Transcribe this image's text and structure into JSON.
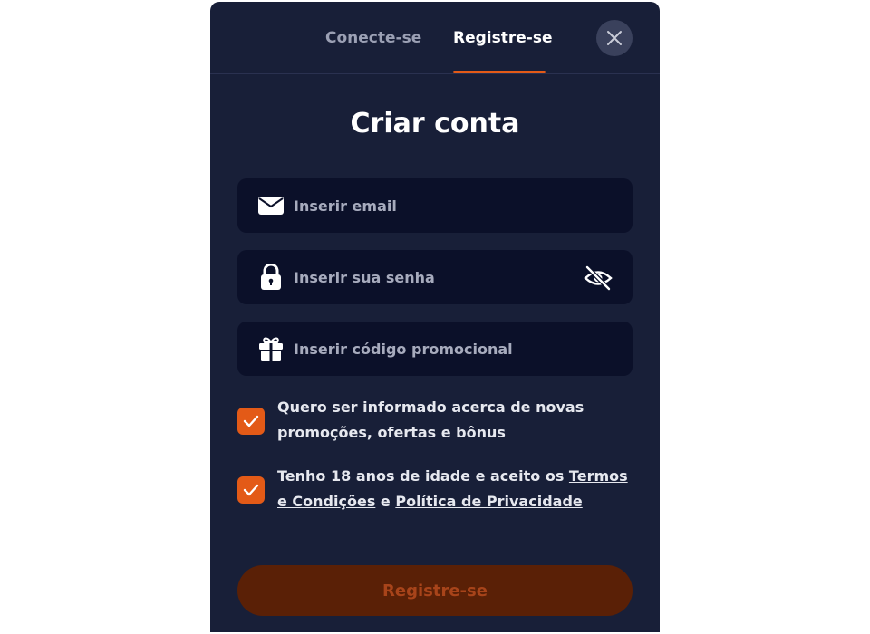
{
  "tabs": {
    "login": "Conecte-se",
    "register": "Registre-se"
  },
  "title": "Criar conta",
  "fields": {
    "email": {
      "placeholder": "Inserir email",
      "value": ""
    },
    "password": {
      "placeholder": "Inserir sua senha",
      "value": ""
    },
    "promo": {
      "placeholder": "Inserir código promocional",
      "value": ""
    }
  },
  "consents": {
    "marketing": {
      "checked": true,
      "text": "Quero ser informado acerca de novas promoções, ofertas e bônus"
    },
    "age": {
      "checked": true,
      "text_before": "Tenho 18 anos de idade e aceito os ",
      "terms_link": "Termos e Condições",
      "connector": " e ",
      "privacy_link": "Política de Privacidade"
    }
  },
  "submit_label": "Registre-se",
  "icons": {
    "email": "envelope-icon",
    "password": "lock-icon",
    "promo": "gift-icon",
    "visibility": "eye-off-icon",
    "close": "close-icon",
    "check": "check-icon"
  },
  "colors": {
    "background": "#181f38",
    "field": "#0b1029",
    "accent": "#e35a17",
    "submit_bg": "#5a2006",
    "submit_text": "#a8441a"
  }
}
